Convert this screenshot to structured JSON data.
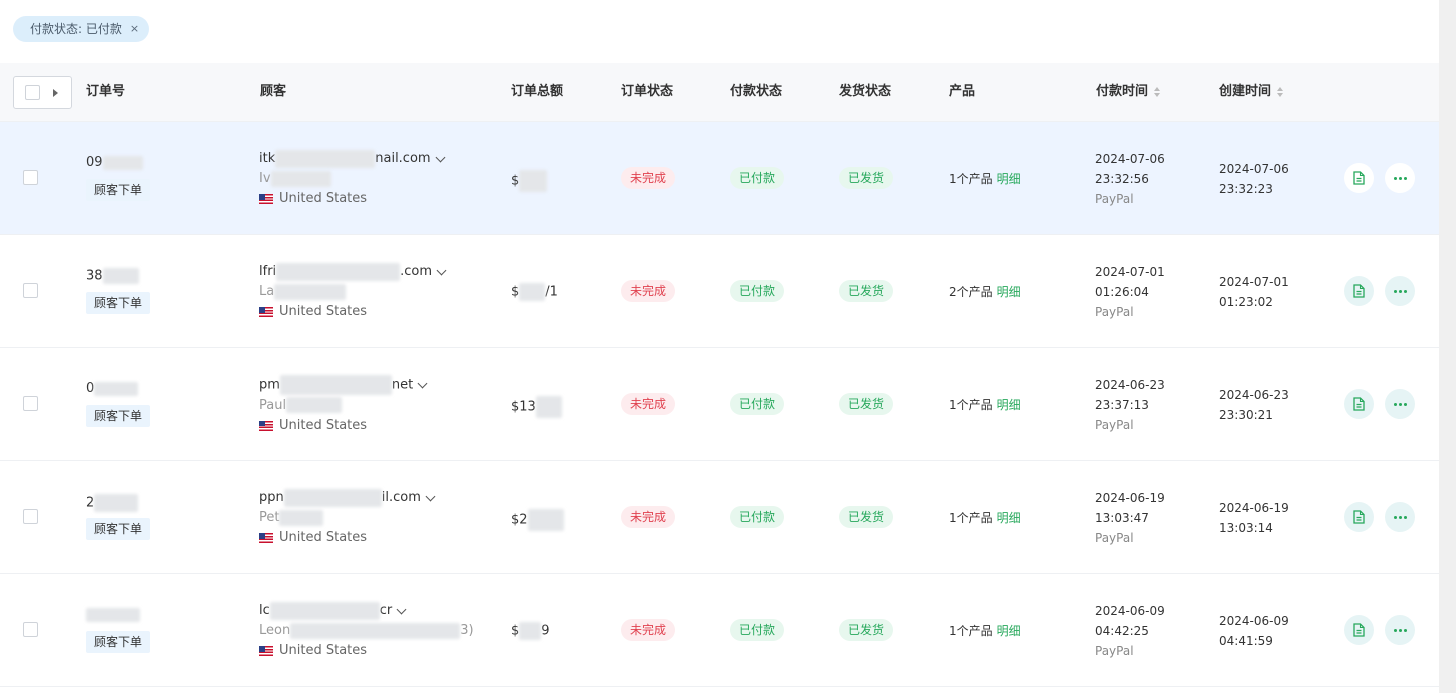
{
  "filter": {
    "chip_label": "付款状态: 已付款",
    "close_glyph": "×"
  },
  "table": {
    "headers": {
      "order_no": "订单号",
      "customer": "顾客",
      "total": "订单总额",
      "order_status": "订单状态",
      "payment_status": "付款状态",
      "shipping_status": "发货状态",
      "product": "产品",
      "paid_time": "付款时间",
      "created_time": "创建时间"
    },
    "rows": [
      {
        "order_no": "09",
        "source": "顾客下单",
        "email_start": "itk",
        "email_end": "nail.com",
        "name": "Iv",
        "country": "United States",
        "amount": "$",
        "order_status": "未完成",
        "payment_status": "已付款",
        "shipping_status": "已发货",
        "product_count": "1个产品",
        "product_link": "明细",
        "paid_date": "2024-07-06",
        "paid_clock": "23:32:56",
        "gateway": "PayPal",
        "created_date": "2024-07-06",
        "created_clock": "23:32:23"
      },
      {
        "order_no": "38",
        "source": "顾客下单",
        "email_start": "lfri",
        "email_end": ".com",
        "name": "La",
        "country": "United States",
        "amount": "$",
        "amount_tail": "/1",
        "order_status": "未完成",
        "payment_status": "已付款",
        "shipping_status": "已发货",
        "product_count": "2个产品",
        "product_link": "明细",
        "paid_date": "2024-07-01",
        "paid_clock": "01:26:04",
        "gateway": "PayPal",
        "created_date": "2024-07-01",
        "created_clock": "01:23:02"
      },
      {
        "order_no": "0",
        "source": "顾客下单",
        "email_start": "pm",
        "email_end": "net",
        "name": "Paul",
        "country": "United States",
        "amount": "$13",
        "order_status": "未完成",
        "payment_status": "已付款",
        "shipping_status": "已发货",
        "product_count": "1个产品",
        "product_link": "明细",
        "paid_date": "2024-06-23",
        "paid_clock": "23:37:13",
        "gateway": "PayPal",
        "created_date": "2024-06-23",
        "created_clock": "23:30:21"
      },
      {
        "order_no": "2",
        "source": "顾客下单",
        "email_start": "ppn",
        "email_end": "il.com",
        "name": "Pet",
        "country": "United States",
        "amount": "$2",
        "order_status": "未完成",
        "payment_status": "已付款",
        "shipping_status": "已发货",
        "product_count": "1个产品",
        "product_link": "明细",
        "paid_date": "2024-06-19",
        "paid_clock": "13:03:47",
        "gateway": "PayPal",
        "created_date": "2024-06-19",
        "created_clock": "13:03:14"
      },
      {
        "order_no": "",
        "source": "顾客下单",
        "email_start": "lc",
        "email_end": "cr",
        "name": "Leon",
        "name_tail": "3)",
        "country": "United States",
        "amount": "$",
        "amount_tail": "9",
        "order_status": "未完成",
        "payment_status": "已付款",
        "shipping_status": "已发货",
        "product_count": "1个产品",
        "product_link": "明细",
        "paid_date": "2024-06-09",
        "paid_clock": "04:42:25",
        "gateway": "PayPal",
        "created_date": "2024-06-09",
        "created_clock": "04:41:59"
      }
    ]
  },
  "icons": {
    "document": "document-icon",
    "more": "more-dots-icon",
    "flag": "us-flag-icon",
    "sort": "sort-caret-icon"
  },
  "colors": {
    "danger": "#e0414f",
    "success": "#27a85c",
    "chip_bg": "#dceefb",
    "row_highlight": "#edf4ff"
  }
}
